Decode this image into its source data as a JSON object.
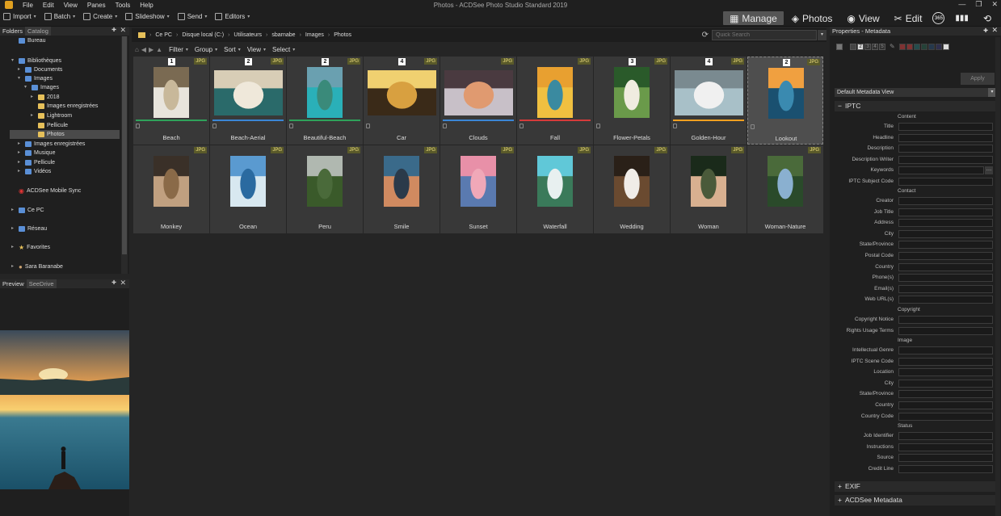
{
  "app": {
    "title": "Photos - ACDSee Photo Studio Standard 2019"
  },
  "menu": [
    "File",
    "Edit",
    "View",
    "Panes",
    "Tools",
    "Help"
  ],
  "toolbar": {
    "items": [
      {
        "label": "Import",
        "icon": "import-icon"
      },
      {
        "label": "Batch",
        "icon": "batch-icon"
      },
      {
        "label": "Create",
        "icon": "create-icon"
      },
      {
        "label": "Slideshow",
        "icon": "slideshow-icon"
      },
      {
        "label": "Send",
        "icon": "send-icon"
      },
      {
        "label": "Editors",
        "icon": "editors-icon"
      }
    ]
  },
  "modes": [
    {
      "label": "Manage",
      "active": true
    },
    {
      "label": "Photos",
      "active": false
    },
    {
      "label": "View",
      "active": false
    },
    {
      "label": "Edit",
      "active": false
    }
  ],
  "badge_365": "365",
  "folders_pane": {
    "tab_folders": "Folders",
    "tab_catalog": "Catalog"
  },
  "tree": [
    {
      "label": "Bureau",
      "indent": 0,
      "icon": "fb"
    },
    {
      "label": "Bibliothèques",
      "indent": 0,
      "icon": "fb",
      "expand": "▾"
    },
    {
      "label": "Documents",
      "indent": 1,
      "icon": "fb",
      "expand": "▸"
    },
    {
      "label": "Images",
      "indent": 1,
      "icon": "fb",
      "expand": "▾"
    },
    {
      "label": "Images",
      "indent": 2,
      "icon": "fb",
      "expand": "▾"
    },
    {
      "label": "2018",
      "indent": 3,
      "icon": "fi",
      "expand": "▸"
    },
    {
      "label": "Images enregistrées",
      "indent": 3,
      "icon": "fi"
    },
    {
      "label": "Lightroom",
      "indent": 3,
      "icon": "fi",
      "expand": "▸"
    },
    {
      "label": "Pellicule",
      "indent": 3,
      "icon": "fi"
    },
    {
      "label": "Photos",
      "indent": 3,
      "icon": "fi",
      "selected": true
    },
    {
      "label": "Images enregistrées",
      "indent": 1,
      "icon": "fb",
      "expand": "▸"
    },
    {
      "label": "Musique",
      "indent": 1,
      "icon": "fb",
      "expand": "▸"
    },
    {
      "label": "Pellicule",
      "indent": 1,
      "icon": "fb",
      "expand": "▸"
    },
    {
      "label": "Vidéos",
      "indent": 1,
      "icon": "fb",
      "expand": "▸"
    },
    {
      "label": "ACDSee Mobile Sync",
      "indent": 0,
      "icon": "sync"
    },
    {
      "label": "Ce PC",
      "indent": 0,
      "icon": "fb",
      "expand": "▸"
    },
    {
      "label": "Réseau",
      "indent": 0,
      "icon": "fb",
      "expand": "▸"
    },
    {
      "label": "Favorites",
      "indent": 0,
      "icon": "star",
      "expand": "▸"
    },
    {
      "label": "Sara Baranabe",
      "indent": 0,
      "icon": "user",
      "expand": "▸"
    }
  ],
  "preview_pane": {
    "tab_preview": "Preview",
    "tab_seedrive": "SeeDrive"
  },
  "path": [
    "Ce PC",
    "Disque local (C:)",
    "Utilisateurs",
    "sbarnabe",
    "Images",
    "Photos"
  ],
  "quick_search": {
    "placeholder": "Quick Search"
  },
  "filterbar": [
    "Filter",
    "Group",
    "Sort",
    "View",
    "Select"
  ],
  "badge_jpg": "JPG",
  "thumbnails": [
    {
      "label": "Beach",
      "num": "1",
      "bar": "#2fa25a",
      "c1": "#7a6a52",
      "c2": "#c8b89a",
      "c3": "#e8e4dc",
      "portrait": true
    },
    {
      "label": "Beach-Aerial",
      "num": "2",
      "bar": "#3b86d6",
      "c1": "#d8cdb6",
      "c2": "#efe8da",
      "c3": "#2a6a6a",
      "portrait": false
    },
    {
      "label": "Beautiful-Beach",
      "num": "2",
      "bar": "#2fa25a",
      "c1": "#6aa0b0",
      "c2": "#3a8a7a",
      "c3": "#2ab0b8",
      "portrait": true
    },
    {
      "label": "Car",
      "num": "4",
      "bar": null,
      "c1": "#f0d070",
      "c2": "#d8a040",
      "c3": "#3a2a18",
      "portrait": false
    },
    {
      "label": "Clouds",
      "num": "",
      "bar": "#3b86d6",
      "c1": "#4a3a40",
      "c2": "#e09a70",
      "c3": "#c8c0c8",
      "portrait": false
    },
    {
      "label": "Fall",
      "num": "",
      "bar": "#d63b3b",
      "c1": "#e8a030",
      "c2": "#3a8aa0",
      "c3": "#f0c040",
      "portrait": true
    },
    {
      "label": "Flower-Petals",
      "num": "3",
      "bar": null,
      "c1": "#2a5a2a",
      "c2": "#f0ece0",
      "c3": "#6a9a4a",
      "portrait": true
    },
    {
      "label": "Golden-Hour",
      "num": "4",
      "bar": "#f0a020",
      "c1": "#7a8a90",
      "c2": "#f0f0f0",
      "c3": "#a8c0c8",
      "portrait": false
    },
    {
      "label": "Lookout",
      "num": "2",
      "bar": null,
      "c1": "#f0a040",
      "c2": "#3a8ab0",
      "c3": "#1a5070",
      "portrait": true,
      "selected": true
    },
    {
      "label": "Monkey",
      "num": "",
      "bar": null,
      "c1": "#3a3028",
      "c2": "#8a6a48",
      "c3": "#c0a080",
      "portrait": true
    },
    {
      "label": "Ocean",
      "num": "",
      "bar": null,
      "c1": "#5a9ad0",
      "c2": "#2a6aa0",
      "c3": "#d8e8f0",
      "portrait": true
    },
    {
      "label": "Peru",
      "num": "",
      "bar": null,
      "c1": "#b0b8b0",
      "c2": "#4a6a3a",
      "c3": "#3a5a2a",
      "portrait": true
    },
    {
      "label": "Smile",
      "num": "",
      "bar": null,
      "c1": "#3a6a8a",
      "c2": "#2a3a4a",
      "c3": "#d08a60",
      "portrait": true
    },
    {
      "label": "Sunset",
      "num": "",
      "bar": null,
      "c1": "#e890a8",
      "c2": "#f0a8b8",
      "c3": "#5a7ab0",
      "portrait": true
    },
    {
      "label": "Waterfall",
      "num": "",
      "bar": null,
      "c1": "#60c8d8",
      "c2": "#e8f0f0",
      "c3": "#3a7a5a",
      "portrait": true
    },
    {
      "label": "Wedding",
      "num": "",
      "bar": null,
      "c1": "#2a2018",
      "c2": "#f0ece8",
      "c3": "#6a4a30",
      "portrait": true
    },
    {
      "label": "Woman",
      "num": "",
      "bar": null,
      "c1": "#1a2a1a",
      "c2": "#4a5a3a",
      "c3": "#d8b090",
      "portrait": true
    },
    {
      "label": "Woman-Nature",
      "num": "",
      "bar": null,
      "c1": "#4a6a3a",
      "c2": "#8ab0d0",
      "c3": "#2a4a2a",
      "portrait": true
    }
  ],
  "properties": {
    "title": "Properties - Metadata",
    "label_numbers": [
      "2",
      "3",
      "4",
      "5"
    ],
    "label_colors": [
      "#c04040",
      "#c04040",
      "#2a6a6a",
      "#2a5a4a",
      "#2a4a6a",
      "#3a3a6a"
    ],
    "apply": "Apply",
    "metadata_view": "Default Metadata View",
    "iptc_section": "IPTC",
    "subsections": {
      "content": "Content",
      "contact": "Contact",
      "copyright": "Copyright",
      "image": "Image",
      "status": "Status"
    },
    "fields_content": [
      "Title",
      "Headline",
      "Description",
      "Description Writer",
      "Keywords",
      "IPTC Subject Code"
    ],
    "fields_contact": [
      "Creator",
      "Job Title",
      "Address",
      "City",
      "State/Province",
      "Postal Code",
      "Country",
      "Phone(s)",
      "Email(s)",
      "Web URL(s)"
    ],
    "fields_copyright": [
      "Copyright Notice",
      "Rights Usage Terms"
    ],
    "fields_image": [
      "Intellectual Genre",
      "IPTC Scene Code",
      "Location",
      "City",
      "State/Province",
      "Country",
      "Country Code"
    ],
    "fields_status": [
      "Job Identifier",
      "Instructions",
      "Source",
      "Credit Line"
    ],
    "exif_section": "EXIF",
    "acdsee_section": "ACDSee Metadata"
  }
}
